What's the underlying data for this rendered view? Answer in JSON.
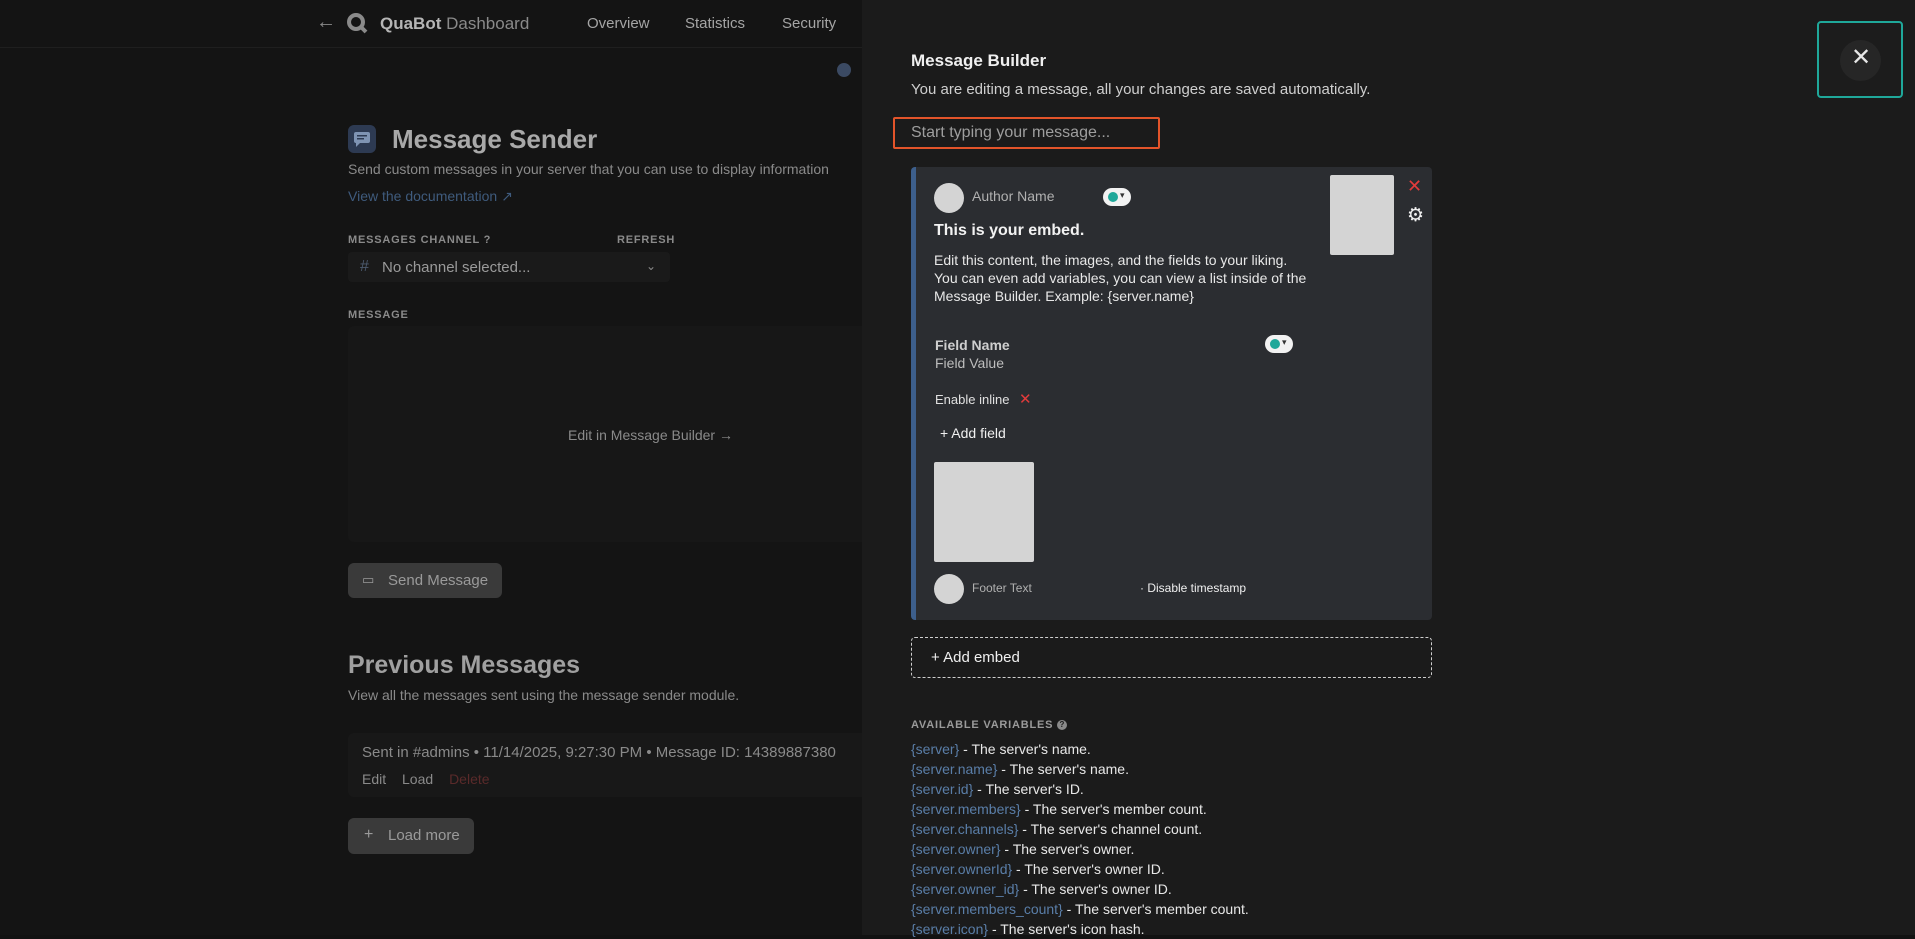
{
  "background_page": {
    "nav": {
      "back_glyph": "←",
      "brand_name": "QuaBot",
      "brand_suffix": "Dashboard",
      "items": [
        "Overview",
        "Statistics",
        "Security"
      ]
    },
    "module": {
      "title": "Message Sender",
      "description": "Send custom messages in your server that you can use to display information",
      "doc_link": "View the documentation",
      "channel_label": "MESSAGES CHANNEL",
      "refresh_label": "REFRESH",
      "channel_placeholder": "No channel selected...",
      "message_label": "MESSAGE",
      "edit_link": "Edit in Message Builder",
      "send_button": "Send Message"
    },
    "previous": {
      "title": "Previous Messages",
      "description": "View all the messages sent using the message sender module.",
      "entries": [
        {
          "summary": "Sent in #admins • 11/14/2025, 9:27:30 PM • Message ID: 14389887380",
          "actions": [
            "Edit",
            "Load",
            "Delete"
          ]
        }
      ],
      "load_more": "Load more"
    }
  },
  "drawer": {
    "title": "Message Builder",
    "subtitle": "You are editing a message, all your changes are saved automatically.",
    "input_placeholder": "Start typing your message...",
    "close_icon": "close-icon",
    "embed": {
      "author_name": "Author Name",
      "title": "This is your embed.",
      "description_line1": "Edit this content, the images, and the fields to your liking.",
      "description_line2": "You can even add variables, you can view a list inside of the Message Builder. Example: {server.name}",
      "field_name": "Field Name",
      "field_value": "Field Value",
      "inline_label": "Enable inline",
      "add_field": "+ Add field",
      "footer_text": "Footer Text",
      "timestamp_toggle": "· Disable timestamp",
      "accent_color": "#3d5f8c"
    },
    "add_embed": "+ Add embed",
    "variables_label": "AVAILABLE VARIABLES",
    "variables": [
      {
        "token": "{server}",
        "desc": " - The server's name."
      },
      {
        "token": "{server.name}",
        "desc": " - The server's name."
      },
      {
        "token": "{server.id}",
        "desc": " - The server's ID."
      },
      {
        "token": "{server.members}",
        "desc": " - The server's member count."
      },
      {
        "token": "{server.channels}",
        "desc": " - The server's channel count."
      },
      {
        "token": "{server.owner}",
        "desc": " - The server's owner."
      },
      {
        "token": "{server.ownerId}",
        "desc": " - The server's owner ID."
      },
      {
        "token": "{server.owner_id}",
        "desc": " - The server's owner ID."
      },
      {
        "token": "{server.members_count}",
        "desc": " - The server's member count."
      },
      {
        "token": "{server.icon}",
        "desc": " - The server's icon hash."
      }
    ]
  },
  "colors": {
    "close_focus_ring": "#1fa89a",
    "input_focus_ring": "#e3542a",
    "remove_red": "#e23b3b",
    "variable_token": "#5a7ea8"
  }
}
